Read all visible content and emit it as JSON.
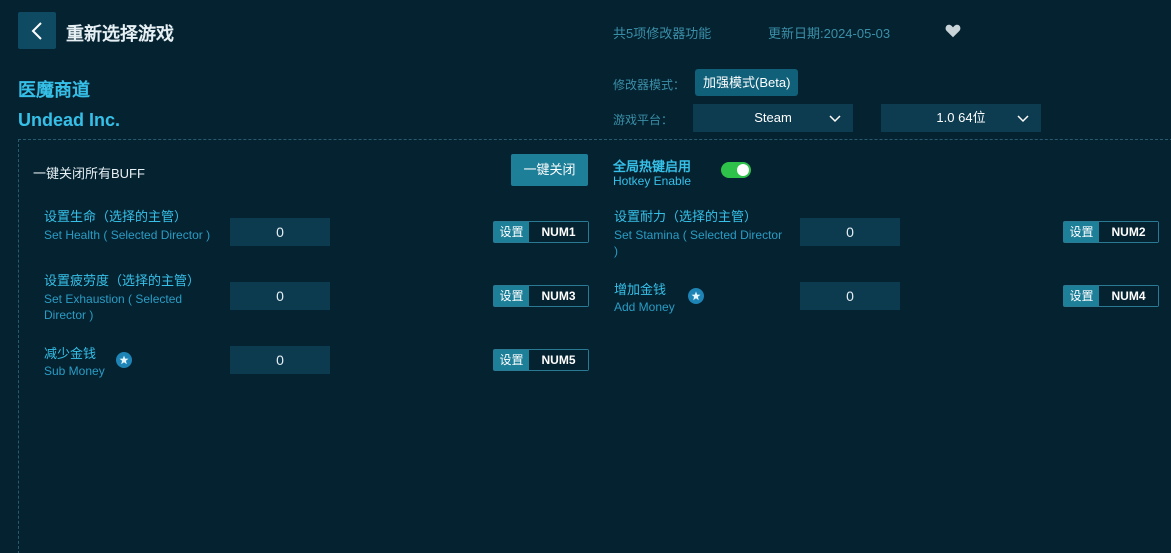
{
  "header": {
    "title": "重新选择游戏",
    "feature_count": "共5项修改器功能",
    "update_date": "更新日期:2024-05-03"
  },
  "game": {
    "name_cn": "医魔商道",
    "name_en": "Undead Inc."
  },
  "mode": {
    "label": "修改器模式：",
    "value": "加强模式(Beta)"
  },
  "platform": {
    "label": "游戏平台：",
    "selected": "Steam",
    "version": "1.0 64位"
  },
  "controls": {
    "close_all_label": "一键关闭所有BUFF",
    "close_all_button": "一键关闭",
    "hotkey_cn": "全局热键启用",
    "hotkey_en": "Hotkey Enable",
    "hotkey_enabled": true
  },
  "features": [
    {
      "cn": "设置生命（选择的主管）",
      "en": "Set Health ( Selected Director )",
      "value": "0",
      "set_label": "设置",
      "key": "NUM1",
      "starred": false
    },
    {
      "cn": "设置耐力（选择的主管）",
      "en": "Set Stamina ( Selected Director )",
      "value": "0",
      "set_label": "设置",
      "key": "NUM2",
      "starred": false
    },
    {
      "cn": "设置疲劳度（选择的主管）",
      "en": "Set Exhaustion ( Selected Director )",
      "value": "0",
      "set_label": "设置",
      "key": "NUM3",
      "starred": false
    },
    {
      "cn": "增加金钱",
      "en": "Add Money",
      "value": "0",
      "set_label": "设置",
      "key": "NUM4",
      "starred": true
    },
    {
      "cn": "减少金钱",
      "en": "Sub Money",
      "value": "0",
      "set_label": "设置",
      "key": "NUM5",
      "starred": true
    }
  ],
  "colors": {
    "background": "#052230",
    "accent": "#36c0e8",
    "button": "#1e7f99",
    "toggle_on": "#2fc24a"
  }
}
